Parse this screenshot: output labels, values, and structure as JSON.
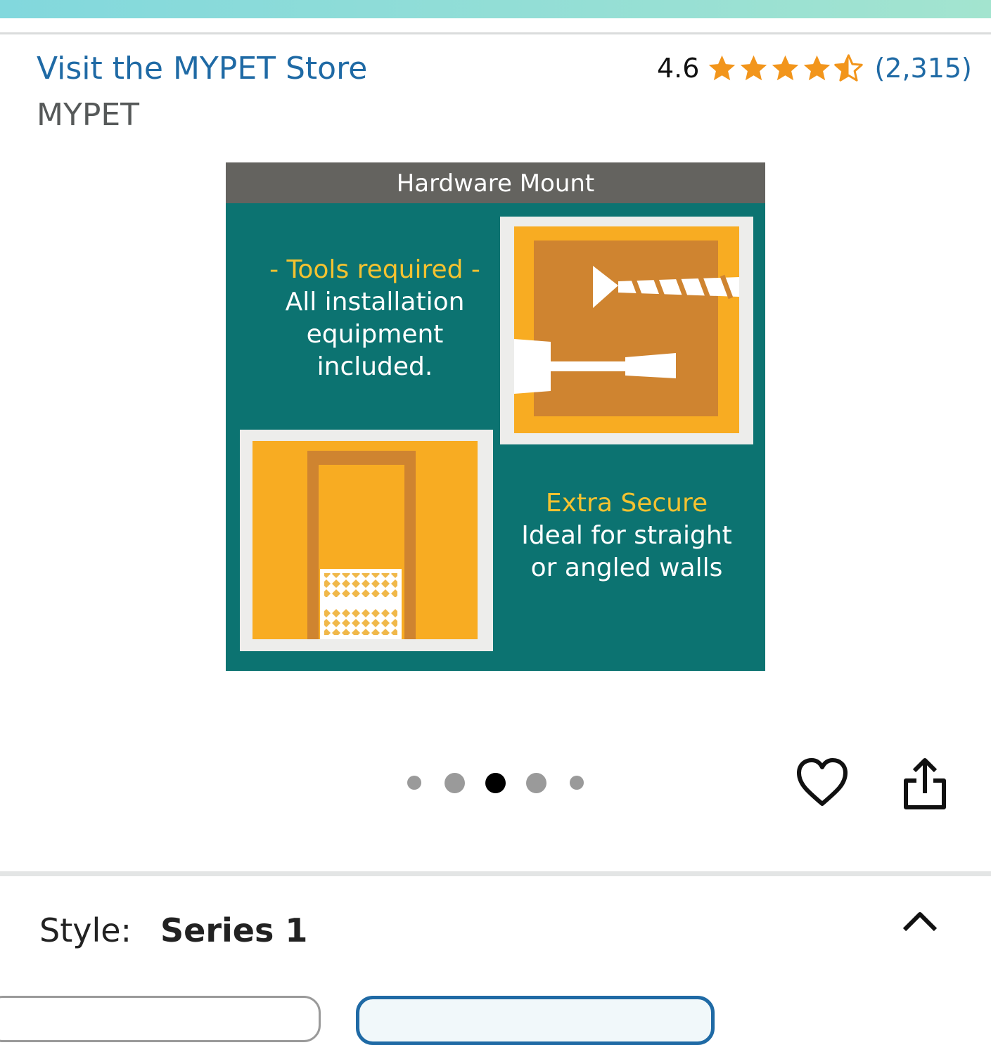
{
  "store": {
    "link_text": "Visit the MYPET Store",
    "brand": "MYPET"
  },
  "rating": {
    "value": "4.6",
    "stars": 4.5,
    "count_text": "(2,315)",
    "star_color": "#f2951b"
  },
  "product_image": {
    "header": "Hardware Mount",
    "block1": {
      "highlight": "- Tools required -",
      "lines": [
        "All installation",
        "equipment",
        "included."
      ]
    },
    "block2": {
      "highlight": "Extra Secure",
      "lines": [
        "Ideal for straight",
        "or angled walls"
      ]
    }
  },
  "carousel": {
    "total": 5,
    "active_index": 2
  },
  "actions": {
    "favorite_icon": "heart-icon",
    "share_icon": "share-icon"
  },
  "variation": {
    "label": "Style:",
    "value": "Series 1",
    "toggle_icon": "chevron-up-icon"
  },
  "colors": {
    "link": "#1f6aa5",
    "teal": "#0c7371",
    "orange": "#f8ac22",
    "highlight": "#f4c230"
  }
}
